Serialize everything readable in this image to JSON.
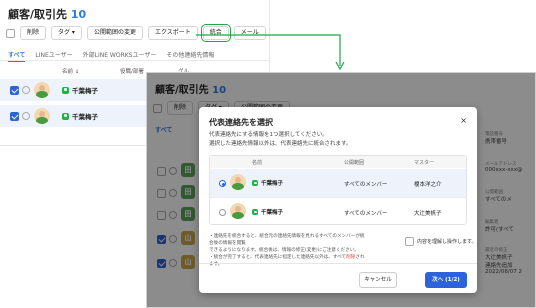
{
  "screenA": {
    "title": "顧客/取引先",
    "count": "10",
    "toolbar": [
      "削除",
      "タグ ▾",
      "公開範囲の変更",
      "エクスポート",
      "統合",
      "メール",
      "ト"
    ],
    "tabs": [
      "すべて",
      "LINEユーザー",
      "外部LINE WORKSユーザー",
      "その他連絡先情報"
    ],
    "table_headers": {
      "name": "名前 ↓",
      "title": "役職/部署",
      "group": "グル"
    },
    "rows": [
      {
        "name": "千葉梅子",
        "selected": true
      },
      {
        "name": "千葉梅子",
        "selected": true
      }
    ],
    "highlight_color": "#22a447"
  },
  "screenB": {
    "title": "顧客/取引先",
    "count": "10",
    "toolbar": [
      "削除",
      "タグ ▾",
      "公開範囲の変更"
    ],
    "tab_active": "すべて",
    "side_tiles": [
      "田",
      "田",
      "田",
      "山",
      "山"
    ],
    "right_panel": [
      {
        "label": "電話番号",
        "value": "携帯番号"
      },
      {
        "label": "メールアドレス",
        "value": "000xxx-xxx@"
      },
      {
        "label": "公開範囲",
        "value": "すべてのメ"
      },
      {
        "label": "編集者",
        "value": "許可(すべて"
      },
      {
        "label": "最近の修正",
        "value": "大辻美帆子"
      },
      {
        "label": "",
        "value": "連絡先追加"
      },
      {
        "label": "",
        "value": "2022/08/07 2"
      }
    ],
    "modal": {
      "title": "代表連絡先を選択",
      "close": "×",
      "desc_line1": "代表連絡先にする情報を1つ選択してください。",
      "desc_line2": "選択した連絡先情報以外は、代表連絡先に統合されます。",
      "headers": {
        "name": "名前",
        "scope": "公開範囲",
        "master": "マスター"
      },
      "rows": [
        {
          "name": "千葉梅子",
          "scope": "すべてのメンバー",
          "master": "榎本洋之介",
          "selected": true
        },
        {
          "name": "千葉梅子",
          "scope": "すべてのメンバー",
          "master": "大辻美帆子",
          "selected": false
        }
      ],
      "note1": "・連絡先を統合すると、統合元の連絡先情報を見れるすべてのメンバーが統合後の情報を閲覧",
      "note1b": "できるようになります。統合後は、情報の修正(変更)にご注意ください。",
      "note2": "・統合が完了すると、代表連絡先に指定した連絡先以外は、すべて",
      "note2_red": "削除",
      "note2_tail": "されます。",
      "agree_label": "内容を理解し操作します。",
      "cancel": "キャンセル",
      "next": "次へ (1/2)"
    }
  },
  "colors": {
    "primary": "#2d63d8",
    "link": "#2d7be5",
    "arrow": "#22a447"
  }
}
